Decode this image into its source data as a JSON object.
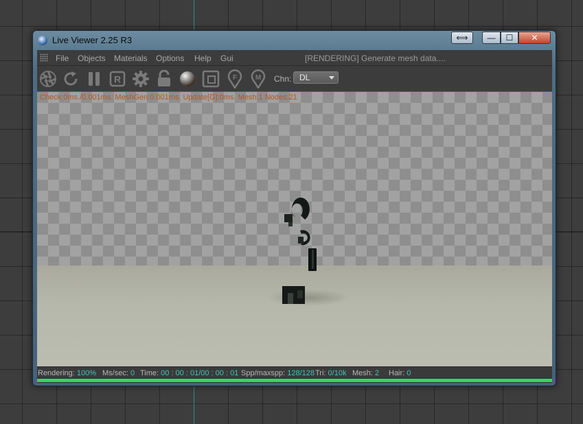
{
  "window": {
    "title": "Live Viewer 2.25 R3",
    "swap_glyph": "⟺",
    "minimize_glyph": "—",
    "maximize_glyph": "☐",
    "close_glyph": "✕"
  },
  "menu": {
    "items": [
      "File",
      "Objects",
      "Materials",
      "Options",
      "Help",
      "Gui"
    ],
    "status_message": "[RENDERING] Generate mesh data...."
  },
  "toolbar": {
    "icons": [
      "aperture-icon",
      "refresh-icon",
      "pause-icon",
      "render-region-icon",
      "settings-gear-icon",
      "unlock-icon",
      "material-sphere-icon",
      "region-frame-icon",
      "focus-pin-icon",
      "material-pin-icon"
    ],
    "region_letter": "R",
    "focus_letter": "F",
    "material_letter": "M",
    "channel_label": "Chn:",
    "channel_value": "DL"
  },
  "viewport": {
    "debug_text": "Check:0ms./0.001ms. MeshGen:0.001ms. Update[G]:0ms. Mesh:1 Nodes:21"
  },
  "statusbar": {
    "rendering_label": "Rendering:",
    "rendering_value": "100%",
    "ms_label": "Ms/sec:",
    "ms_value": "0",
    "time_label": "Time:",
    "time_value": "00 : 00 : 01/00 : 00 : 01",
    "spp_label": "Spp/maxspp:",
    "spp_value": "128/128",
    "tri_label": "Tri:",
    "tri_value": "0/10k",
    "mesh_label": "Mesh:",
    "mesh_value": "2",
    "hair_label": "Hair:",
    "hair_value": "0",
    "progress": 1.0
  },
  "colors": {
    "progress": "#38d65a",
    "value_text": "#3ec5ba",
    "debug_text": "#b5561d",
    "close_button": "#c0462c"
  }
}
